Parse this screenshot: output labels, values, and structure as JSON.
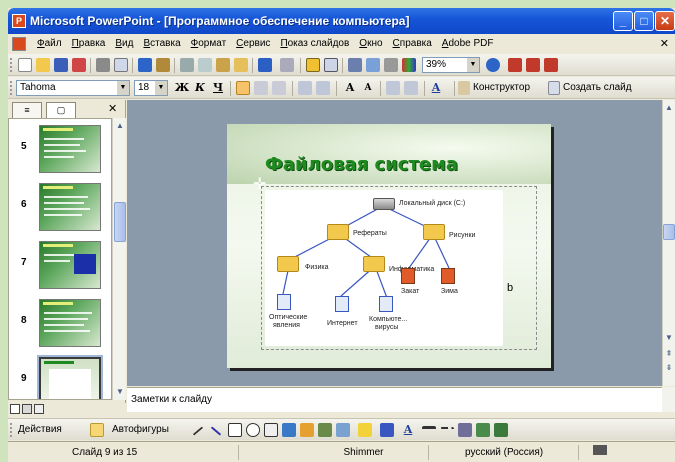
{
  "window": {
    "title": "Microsoft PowerPoint - [Программное обеспечение компьютера]",
    "app_icon": "P",
    "min_glyph": "_",
    "max_glyph": "□",
    "close_glyph": "✕"
  },
  "menu": {
    "items": [
      "Файл",
      "Правка",
      "Вид",
      "Вставка",
      "Формат",
      "Сервис",
      "Показ слайдов",
      "Окно",
      "Справка",
      "Adobe PDF"
    ],
    "close_glyph": "✕"
  },
  "toolbar_standard": {
    "zoom": "39%"
  },
  "toolbar_formatting": {
    "font_name": "Tahoma",
    "font_size": "18",
    "bold": "Ж",
    "italic": "К",
    "underline": "Ч",
    "designer_label": "Конструктор",
    "new_slide_label": "Создать слайд"
  },
  "panel": {
    "tab_outline": "≡",
    "tab_slides": "▢",
    "close_glyph": "✕",
    "thumbnails": [
      {
        "number": "5"
      },
      {
        "number": "6"
      },
      {
        "number": "7"
      },
      {
        "number": "8"
      },
      {
        "number": "9"
      }
    ]
  },
  "slide": {
    "title": "Файловая система",
    "stray_text": "b",
    "diagram": {
      "root": "Локальный диск (C:)",
      "nodes": [
        "Рефераты",
        "Рисунки",
        "Физика",
        "Информатика",
        "Закат",
        "Зима",
        "Оптические явления",
        "Интернет",
        "Компьютерные вирусы"
      ],
      "node_labels_display": [
        "Рефераты",
        "Рисунки",
        "Физика",
        "Информатика",
        "Закат",
        "Зима",
        "Оптические",
        "явления",
        "Интернет",
        "Компьюте...",
        "вирусы"
      ]
    }
  },
  "notes": {
    "placeholder": "Заметки к слайду"
  },
  "drawing_toolbar": {
    "actions_label": "Действия",
    "autoshapes_label": "Автофигуры"
  },
  "status": {
    "slide_position": "Слайд 9 из 15",
    "design": "Shimmer",
    "language": "русский (Россия)"
  },
  "colors": {
    "title_bar": "#1656d8",
    "slide_title": "#1f8a1f",
    "canvas_bg": "#8b9aab",
    "folder": "#f2c94c",
    "diagram_line": "#3a56c0"
  }
}
